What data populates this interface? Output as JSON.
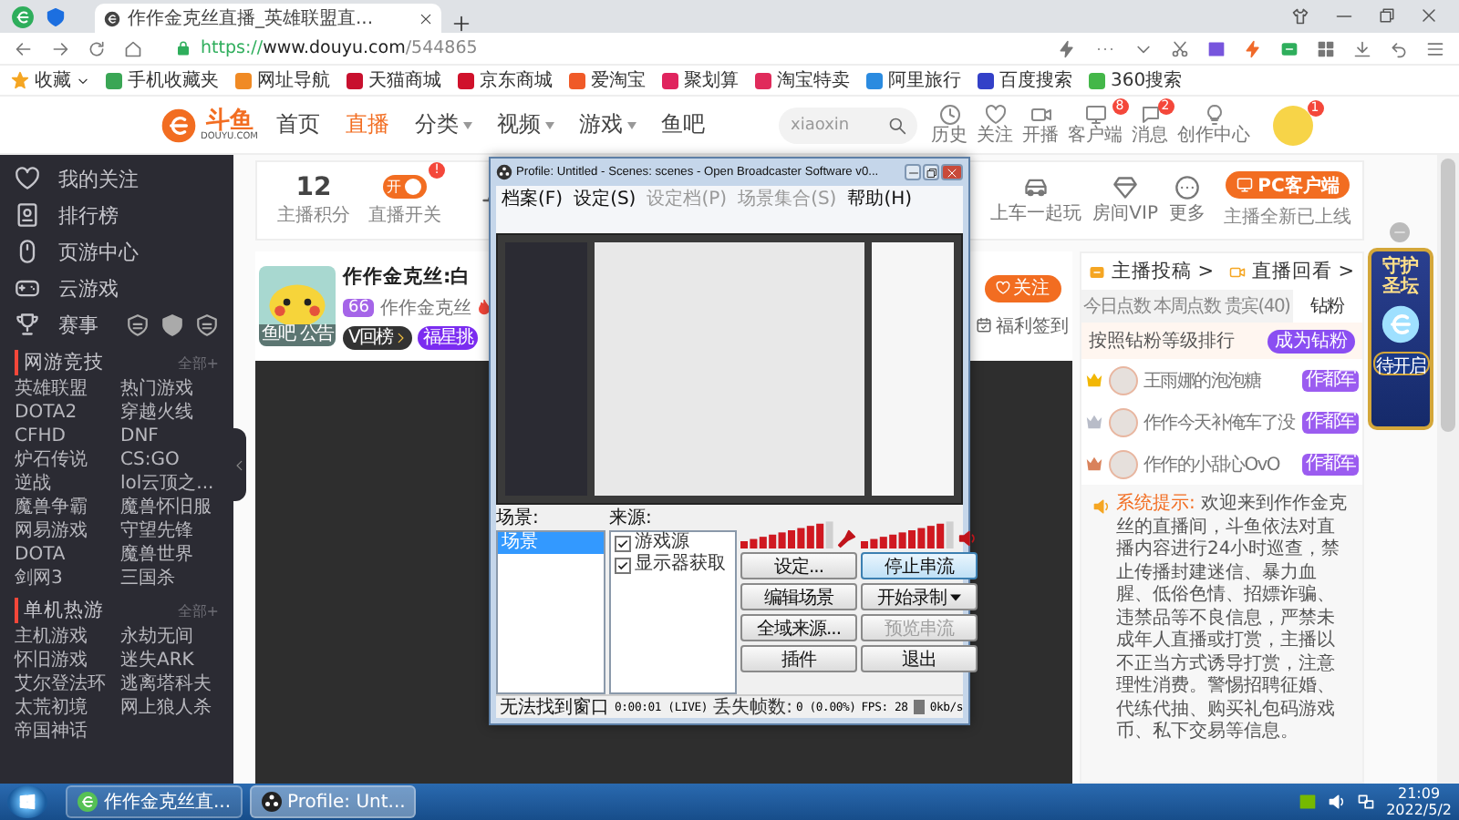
{
  "browser": {
    "tabs": [
      {
        "title": "作作金克丝直播_英雄联盟直...",
        "selected": true
      }
    ],
    "url": {
      "scheme": "https://",
      "host": "www.douyu.com",
      "path": "/544865"
    },
    "bookmarks": [
      "收藏",
      "手机收藏夹",
      "网址导航",
      "天猫商城",
      "京东商城",
      "爱淘宝",
      "聚划算",
      "淘宝特卖",
      "阿里旅行",
      "百度搜索",
      "360搜索"
    ]
  },
  "site": {
    "logo": "斗鱼",
    "logo_sub": "DOUYU.COM",
    "nav": [
      {
        "label": "首页",
        "selected": false,
        "menu": false
      },
      {
        "label": "直播",
        "selected": true,
        "menu": false
      },
      {
        "label": "分类",
        "selected": false,
        "menu": true
      },
      {
        "label": "视频",
        "selected": false,
        "menu": true
      },
      {
        "label": "游戏",
        "selected": false,
        "menu": true
      },
      {
        "label": "鱼吧",
        "selected": false,
        "menu": false
      }
    ],
    "search": {
      "placeholder": "xiaoxin"
    },
    "actions": [
      {
        "label": "历史"
      },
      {
        "label": "关注"
      },
      {
        "label": "开播"
      },
      {
        "label": "客户端",
        "badge": "8"
      },
      {
        "label": "消息",
        "badge": "2"
      },
      {
        "label": "创作中心"
      }
    ],
    "avatar_badge": "1"
  },
  "sidebar": {
    "links": [
      {
        "label": "我的关注"
      },
      {
        "label": "排行榜"
      },
      {
        "label": "页游中心"
      },
      {
        "label": "云游戏"
      },
      {
        "label": "赛事"
      }
    ],
    "sections": [
      {
        "title": "网游竞技",
        "more": "全部+",
        "games": [
          "英雄联盟",
          "热门游戏",
          "DOTA2",
          "穿越火线",
          "CFHD",
          "DNF",
          "炉石传说",
          "CS:GO",
          "逆战",
          "lol云顶之...",
          "魔兽争霸",
          "魔兽怀旧服",
          "网易游戏",
          "守望先锋",
          "DOTA",
          "魔兽世界",
          "剑网3",
          "三国杀"
        ]
      },
      {
        "title": "单机热游",
        "more": "全部+",
        "games": [
          "主机游戏",
          "永劫无间",
          "怀旧游戏",
          "迷失ARK",
          "艾尔登法环",
          "逃离塔科夫",
          "太荒初境",
          "网上狼人杀",
          "帝国神话"
        ]
      }
    ]
  },
  "stats": [
    {
      "kind": "score",
      "value": "12",
      "label": "主播积分"
    },
    {
      "kind": "toggle",
      "label": "直播开关",
      "toggle_text": "开",
      "on": true,
      "badge": "!"
    },
    {
      "kind": "waveform"
    }
  ],
  "room_actions": [
    {
      "label": "上车一起玩"
    },
    {
      "label": "房间VIP"
    },
    {
      "label": "更多"
    }
  ],
  "pc_client": {
    "button": "PC客户端",
    "note": "主播全新已上线"
  },
  "streamer": {
    "name": "作作金克丝:白",
    "avatar_tags": [
      "鱼吧",
      "公告"
    ],
    "level": "66",
    "nickname": "作作金克丝",
    "badges": [
      "V回榜",
      "福星挑"
    ],
    "follow": "关注",
    "checkin": "福利签到"
  },
  "fan_panel": {
    "links": [
      "主播投稿 >",
      "直播回看 >"
    ],
    "tabs": [
      {
        "label": "今日点数",
        "selected": false
      },
      {
        "label": "本周点数",
        "selected": false
      },
      {
        "label": "贵宾(40)",
        "selected": false
      },
      {
        "label": "钻粉",
        "selected": true
      }
    ],
    "rank_title": "按照钻粉等级排行",
    "join": "成为钻粉",
    "ranking": [
      {
        "name": "王雨娜的泡泡糖",
        "badge": "作都军",
        "color": "#f2b705"
      },
      {
        "name": "作作今天补俺车了没",
        "badge": "作都军",
        "color": "#b8bcc8"
      },
      {
        "name": "作作的小甜心OvO",
        "badge": "作都军",
        "color": "#d9825b"
      }
    ],
    "notice": {
      "label": "系统提示:",
      "text": "欢迎来到作作金克丝的直播间，斗鱼依法对直播内容进行24小时巡查，禁止传播封建迷信、暴力血腥、低俗色情、招嫖诈骗、违禁品等不良信息，严禁未成年人直播或打赏，主播以不正当方式诱导打赏，注意理性消费。警惕招聘征婚、代练代抽、购买礼包码游戏币、私下交易等信息。"
    }
  },
  "floating_ad": {
    "title": "守护圣坛",
    "button": "待开启"
  },
  "obs_window": {
    "title": "Profile: Untitled - Scenes: scenes - Open Broadcaster Software v0...",
    "menu": [
      {
        "label": "档案(F)",
        "disabled": false
      },
      {
        "label": "设定(S)",
        "disabled": false
      },
      {
        "label": "设定档(P)",
        "disabled": true
      },
      {
        "label": "场景集合(S)",
        "disabled": true
      },
      {
        "label": "帮助(H)",
        "disabled": false
      }
    ],
    "scenes_label": "场景:",
    "scenes": [
      {
        "name": "场景",
        "selected": true
      }
    ],
    "sources_label": "来源:",
    "sources": [
      {
        "name": "游戏源",
        "checked": true
      },
      {
        "name": "显示器获取",
        "checked": true
      }
    ],
    "meters": [
      {
        "kind": "mic",
        "level": 0.85
      },
      {
        "kind": "speaker",
        "level": 0.85
      }
    ],
    "buttons": [
      {
        "label": "设定...",
        "selected": false,
        "disabled": false,
        "dropdown": false
      },
      {
        "label": "停止串流",
        "selected": true,
        "disabled": false,
        "dropdown": false
      },
      {
        "label": "编辑场景",
        "selected": false,
        "disabled": false,
        "dropdown": false
      },
      {
        "label": "开始录制",
        "selected": false,
        "disabled": false,
        "dropdown": true
      },
      {
        "label": "全域来源...",
        "selected": false,
        "disabled": false,
        "dropdown": false
      },
      {
        "label": "预览串流",
        "selected": false,
        "disabled": true,
        "dropdown": false
      },
      {
        "label": "插件",
        "selected": false,
        "disabled": false,
        "dropdown": false
      },
      {
        "label": "退出",
        "selected": false,
        "disabled": false,
        "dropdown": false
      }
    ],
    "status": {
      "message": "无法找到窗口",
      "time": "0:00:01 (LIVE)",
      "dropped_label": "丢失帧数:",
      "dropped": "0 (0.00%)",
      "fps": "FPS: 28",
      "bitrate": "0kb/s"
    }
  },
  "taskbar": {
    "tasks": [
      {
        "label": "作作金克丝直...",
        "kind": "browser",
        "selected": false
      },
      {
        "label": "Profile: Unt...",
        "kind": "obs",
        "selected": true
      }
    ],
    "time": "21:09",
    "date": "2022/5/2"
  }
}
